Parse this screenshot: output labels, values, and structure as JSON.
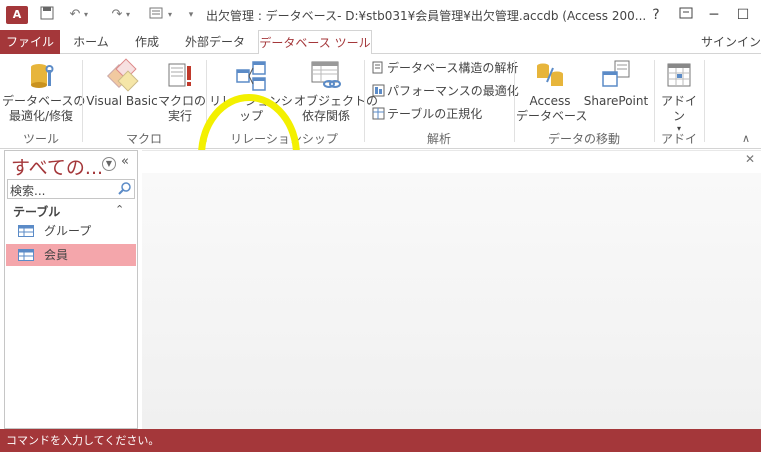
{
  "titlebar": {
    "app_icon": "A",
    "title": "出欠管理 : データベース- D:¥stb031¥会員管理¥出欠管理.accdb (Access 200...",
    "help": "?"
  },
  "tabs": {
    "file": "ファイル",
    "items": [
      "ホーム",
      "作成",
      "外部データ",
      "データベース ツール"
    ],
    "signin": "サインイン"
  },
  "ribbon": {
    "tools_group": {
      "compact_repair": "データベースの\n最適化/修復",
      "label": "ツール"
    },
    "macro_group": {
      "visual_basic": "Visual Basic",
      "run_macro": "マクロの\n実行",
      "label": "マクロ"
    },
    "relationships_group": {
      "relationships": "リレーションシップ",
      "object_dependencies": "オブジェクトの\n依存関係",
      "label": "リレーションシップ"
    },
    "analyze_group": {
      "documenter": "データベース構造の解析",
      "performance": "パフォーマンスの最適化",
      "table": "テーブルの正規化",
      "label": "解析"
    },
    "move_data_group": {
      "access_db": "Access\nデータベース",
      "sharepoint": "SharePoint",
      "label": "データの移動"
    },
    "addins_group": {
      "addins": "アドイン",
      "label": "アドイン"
    }
  },
  "navpane": {
    "header": "すべての...",
    "search_placeholder": "検索...",
    "section": "テーブル",
    "items": [
      {
        "label": "グループ",
        "selected": false
      },
      {
        "label": "会員",
        "selected": true
      }
    ]
  },
  "status": {
    "text": "コマンドを入力してください。"
  },
  "colors": {
    "accent": "#a4373a",
    "highlight": "#f3f000",
    "selected_item": "#f4a6ab"
  }
}
